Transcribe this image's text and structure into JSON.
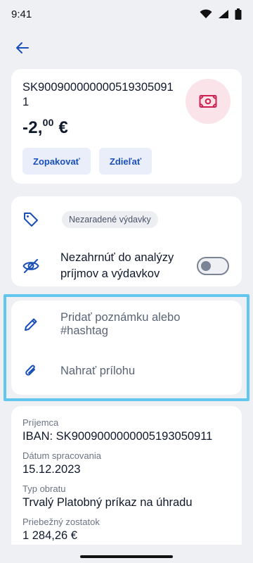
{
  "status_bar": {
    "time": "9:41"
  },
  "transaction": {
    "iban_title": "SK9009000000005193050911",
    "amount_main": "-2,",
    "amount_cents": "00",
    "currency": " €",
    "repeat_label": "Zopakovať",
    "share_label": "Zdieľať"
  },
  "category": {
    "chip_label": "Nezaradené výdavky",
    "exclude_label": "Nezahrnúť do analýzy príjmov a výdavkov",
    "exclude_toggle_on": false
  },
  "note": {
    "add_note_label": "Pridať poznámku alebo #hashtag",
    "attach_label": "Nahrať prílohu"
  },
  "details": {
    "recipient_label": "Príjemca",
    "recipient_value": "IBAN: SK9009000000005193050911",
    "processing_date_label": "Dátum spracovania",
    "processing_date_value": "15.12.2023",
    "turnover_type_label": "Typ obratu",
    "turnover_type_value": "Trvalý Platobný príkaz na úhradu",
    "balance_label": "Priebežný zostatok",
    "balance_value": "1 284,26 €"
  },
  "colors": {
    "accent": "#1b4fb8",
    "money_icon": "#d0214e",
    "highlight": "#62c6ef"
  }
}
